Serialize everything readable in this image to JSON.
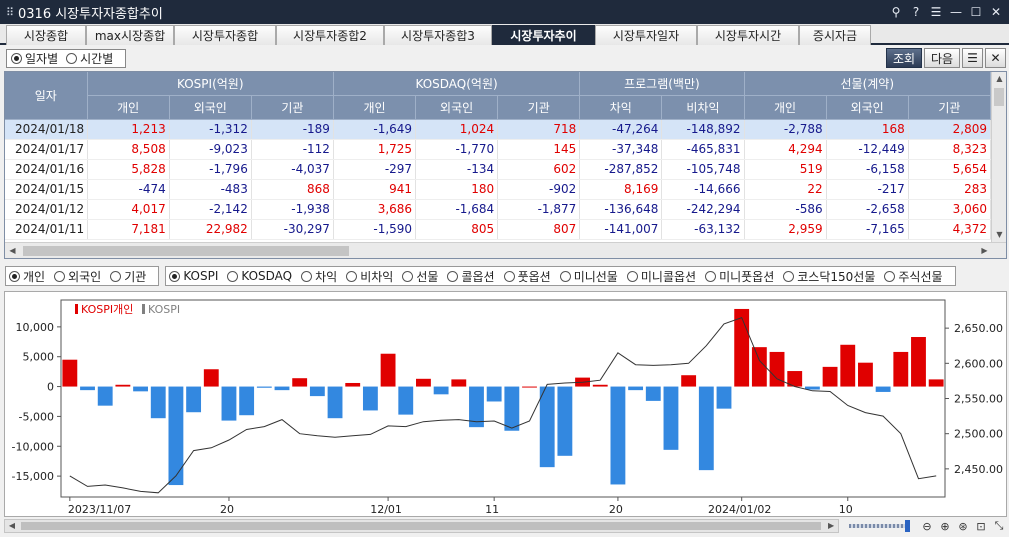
{
  "window": {
    "title": "0316 시장투자자종합추이",
    "grip_glyph": "⠿",
    "controls": [
      "⚲",
      "?",
      "☰",
      "—",
      "☐",
      "✕"
    ]
  },
  "tabs": [
    "시장종합",
    "max시장종합",
    "시장투자종합",
    "시장투자종합2",
    "시장투자종합3",
    "시장투자추이",
    "시장투자일자",
    "시장투자시간",
    "증시자금"
  ],
  "active_tab": 5,
  "mode": {
    "options": [
      "일자별",
      "시간별"
    ],
    "selected": 0
  },
  "buttons": {
    "query": "조회",
    "next": "다음",
    "list_icon": "☰",
    "close_icon": "✕"
  },
  "table": {
    "date_header": "일자",
    "groups": [
      "KOSPI(억원)",
      "KOSDAQ(억원)",
      "프로그램(백만)",
      "선물(계약)"
    ],
    "subheaders": [
      "개인",
      "외국인",
      "기관",
      "개인",
      "외국인",
      "기관",
      "차익",
      "비차익",
      "개인",
      "외국인",
      "기관"
    ],
    "rows": [
      {
        "date": "2024/01/18",
        "values": [
          "1,213",
          "-1,312",
          "-189",
          "-1,649",
          "1,024",
          "718",
          "-47,264",
          "-148,892",
          "-2,788",
          "168",
          "2,809"
        ]
      },
      {
        "date": "2024/01/17",
        "values": [
          "8,508",
          "-9,023",
          "-112",
          "1,725",
          "-1,770",
          "145",
          "-37,348",
          "-465,831",
          "4,294",
          "-12,449",
          "8,323"
        ]
      },
      {
        "date": "2024/01/16",
        "values": [
          "5,828",
          "-1,796",
          "-4,037",
          "-297",
          "-134",
          "602",
          "-287,852",
          "-105,748",
          "519",
          "-6,158",
          "5,654"
        ]
      },
      {
        "date": "2024/01/15",
        "values": [
          "-474",
          "-483",
          "868",
          "941",
          "180",
          "-902",
          "8,169",
          "-14,666",
          "22",
          "-217",
          "283"
        ]
      },
      {
        "date": "2024/01/12",
        "values": [
          "4,017",
          "-2,142",
          "-1,938",
          "3,686",
          "-1,684",
          "-1,877",
          "-136,648",
          "-242,294",
          "-586",
          "-2,658",
          "3,060"
        ]
      },
      {
        "date": "2024/01/11",
        "values": [
          "7,181",
          "22,982",
          "-30,297",
          "-1,590",
          "805",
          "807",
          "-141,007",
          "-63,132",
          "2,959",
          "-7,165",
          "4,372"
        ]
      }
    ]
  },
  "chart_selectors": {
    "investor": {
      "options": [
        "개인",
        "외국인",
        "기관"
      ],
      "selected": 0
    },
    "market": {
      "options": [
        "KOSPI",
        "KOSDAQ",
        "차익",
        "비차익",
        "선물",
        "콜옵션",
        "풋옵션",
        "미니선물",
        "미니콜옵션",
        "미니풋옵션",
        "코스닥150선물",
        "주식선물"
      ],
      "selected": 0
    }
  },
  "chart_data": {
    "type": "bar",
    "legend": [
      {
        "name": "KOSPI개인",
        "color": "#e00000"
      },
      {
        "name": "KOSPI",
        "color": "#808080"
      }
    ],
    "colors": {
      "positive": "#e00000",
      "negative": "#3388e0",
      "line": "#333333"
    },
    "bar_series": {
      "name": "KOSPI개인",
      "values": [
        4500,
        -600,
        -3200,
        300,
        -800,
        -5300,
        -16500,
        -4300,
        2900,
        -5700,
        -4800,
        -200,
        -600,
        1400,
        -1600,
        -5300,
        600,
        -4000,
        5500,
        -4700,
        1300,
        -1300,
        1200,
        -6800,
        -2500,
        -7400,
        0,
        -13500,
        -11600,
        1500,
        300,
        -16400,
        -600,
        -2400,
        -10600,
        1900,
        -14000,
        -3700,
        13000,
        6600,
        5800,
        2600,
        -500,
        3300,
        7000,
        4000,
        -900,
        5800,
        8300,
        1200
      ]
    },
    "line_series": {
      "name": "KOSPI",
      "axis": "right",
      "values": [
        2440,
        2425,
        2427,
        2423,
        2418,
        2416,
        2440,
        2476,
        2480,
        2491,
        2506,
        2510,
        2520,
        2500,
        2497,
        2495,
        2497,
        2499,
        2511,
        2510,
        2517,
        2519,
        2520,
        2517,
        2518,
        2508,
        2518,
        2570,
        2572,
        2573,
        2576,
        2615,
        2598,
        2597,
        2598,
        2600,
        2625,
        2656,
        2665,
        2604,
        2578,
        2567,
        2561,
        2560,
        2540,
        2530,
        2525,
        2500,
        2436,
        2440
      ]
    },
    "x_tick_labels": [
      "2023/11/07",
      "20",
      "12/01",
      "11",
      "20",
      "2024/01/02",
      "10"
    ],
    "y_tick_labels_left": [
      "10,000",
      "5,000",
      "0",
      "-5,000",
      "-10,000",
      "-15,000"
    ],
    "y_tick_labels_right": [
      "2,650.00",
      "2,600.00",
      "2,550.00",
      "2,500.00",
      "2,450.00"
    ],
    "ylim": [
      -18500,
      14500
    ],
    "y2lim": [
      2410,
      2690
    ]
  },
  "footer": {
    "scroll_left_arrow": "◀",
    "scroll_right_arrow": "▶",
    "zoom_icons": [
      "⊖",
      "⊕",
      "⊛",
      "⊡",
      "⤡"
    ]
  }
}
